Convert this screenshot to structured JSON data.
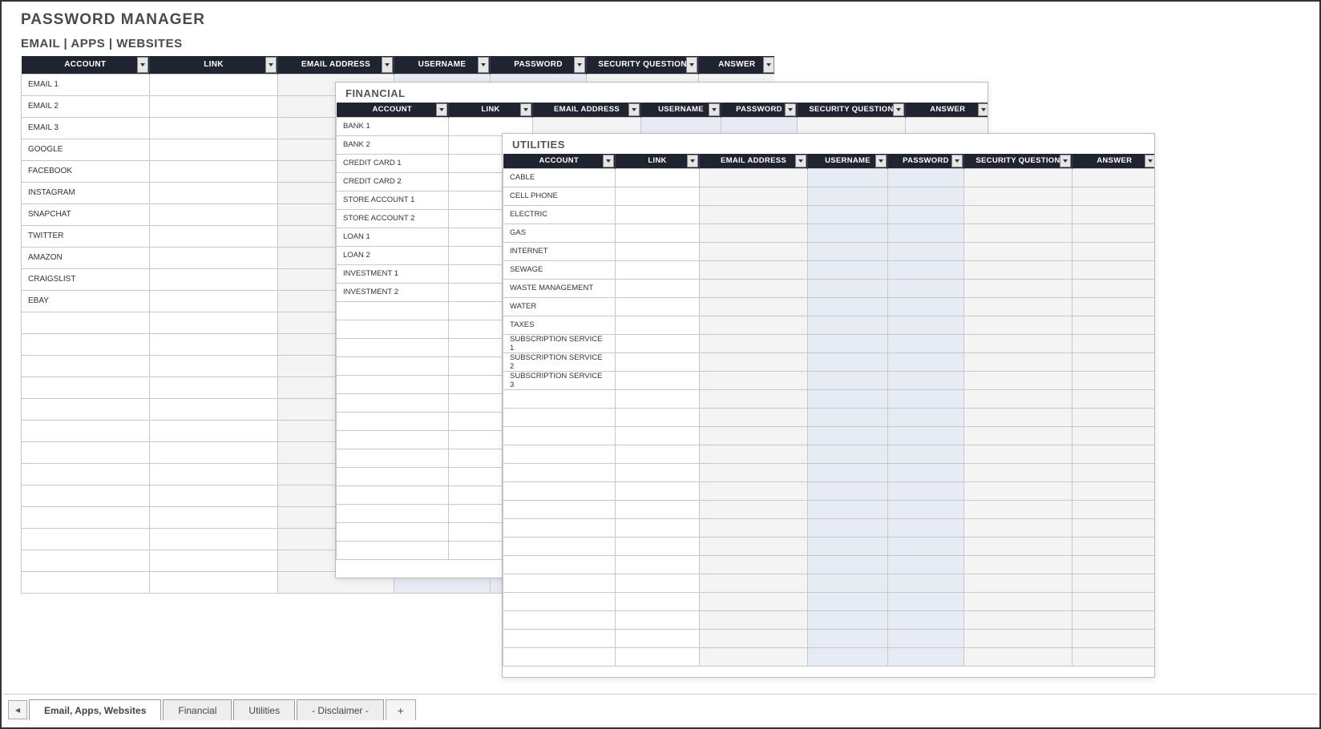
{
  "main": {
    "title": "PASSWORD MANAGER",
    "subtitle": "EMAIL | APPS | WEBSITES"
  },
  "columns": [
    "ACCOUNT",
    "LINK",
    "EMAIL ADDRESS",
    "USERNAME",
    "PASSWORD",
    "SECURITY QUESTION",
    "ANSWER"
  ],
  "sheets": {
    "main": {
      "rows": [
        "EMAIL 1",
        "EMAIL 2",
        "EMAIL 3",
        "GOOGLE",
        "FACEBOOK",
        "INSTAGRAM",
        "SNAPCHAT",
        "TWITTER",
        "AMAZON",
        "CRAIGSLIST",
        "EBAY"
      ],
      "blank_rows": 13
    },
    "financial": {
      "title": "FINANCIAL",
      "rows": [
        "BANK 1",
        "BANK 2",
        "CREDIT CARD 1",
        "CREDIT CARD 2",
        "STORE ACCOUNT 1",
        "STORE ACCOUNT 2",
        "LOAN 1",
        "LOAN 2",
        "INVESTMENT 1",
        "INVESTMENT 2"
      ],
      "blank_rows": 14
    },
    "utilities": {
      "title": "UTILITIES",
      "rows": [
        "CABLE",
        "CELL PHONE",
        "ELECTRIC",
        "GAS",
        "INTERNET",
        "SEWAGE",
        "WASTE MANAGEMENT",
        "WATER",
        "TAXES",
        "SUBSCRIPTION SERVICE 1",
        "SUBSCRIPTION SERVICE 2",
        "SUBSCRIPTION SERVICE 3"
      ],
      "blank_rows": 15
    }
  },
  "tabs": {
    "items": [
      "Email, Apps, Websites",
      "Financial",
      "Utilities",
      "- Disclaimer -"
    ],
    "active": 0,
    "add_label": "+"
  }
}
